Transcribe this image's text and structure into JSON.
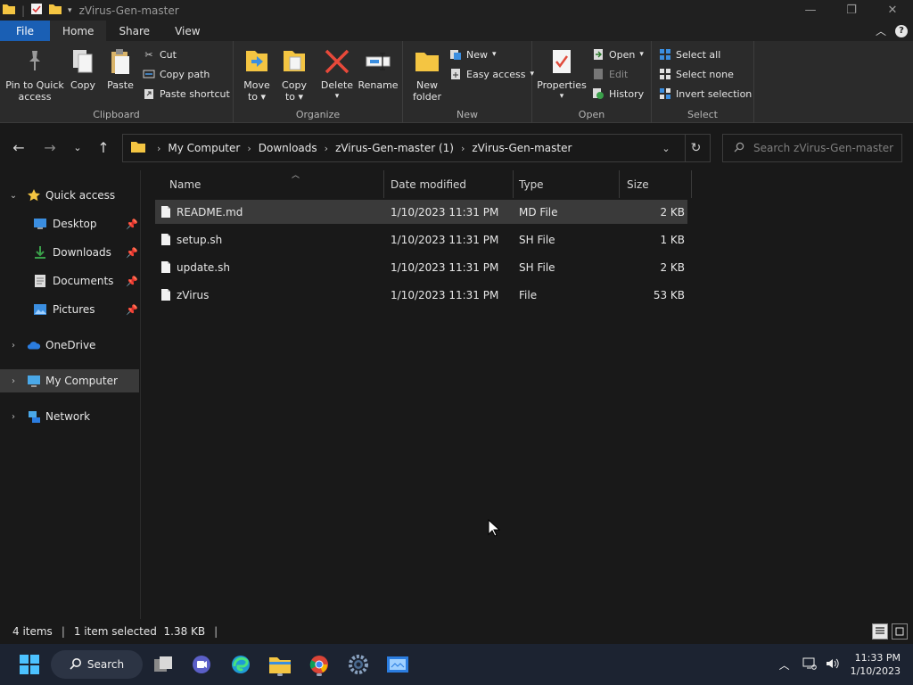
{
  "window": {
    "title": "zVirus-Gen-master"
  },
  "tabs": [
    "File",
    "Home",
    "Share",
    "View"
  ],
  "ribbon": {
    "clipboard": {
      "label": "Clipboard",
      "pin": [
        "Pin to Quick",
        "access"
      ],
      "copy": "Copy",
      "paste": "Paste",
      "cut": "Cut",
      "copy_path": "Copy path",
      "paste_shortcut": "Paste shortcut"
    },
    "organize": {
      "label": "Organize",
      "move_to": [
        "Move",
        "to"
      ],
      "copy_to": [
        "Copy",
        "to"
      ],
      "delete": "Delete",
      "rename": "Rename"
    },
    "new": {
      "label": "New",
      "new_folder": [
        "New",
        "folder"
      ],
      "new_item": "New",
      "easy_access": "Easy access"
    },
    "open": {
      "label": "Open",
      "properties": "Properties",
      "open": "Open",
      "edit": "Edit",
      "history": "History"
    },
    "select": {
      "label": "Select",
      "select_all": "Select all",
      "select_none": "Select none",
      "invert_selection": "Invert selection"
    }
  },
  "address": {
    "segments": [
      "My Computer",
      "Downloads",
      "zVirus-Gen-master (1)",
      "zVirus-Gen-master"
    ]
  },
  "search": {
    "placeholder": "Search zVirus-Gen-master"
  },
  "nav": {
    "quick_access": "Quick access",
    "desktop": "Desktop",
    "downloads": "Downloads",
    "documents": "Documents",
    "pictures": "Pictures",
    "onedrive": "OneDrive",
    "my_computer": "My Computer",
    "network": "Network"
  },
  "columns": {
    "name": "Name",
    "date": "Date modified",
    "type": "Type",
    "size": "Size"
  },
  "files": [
    {
      "name": "README.md",
      "date": "1/10/2023 11:31 PM",
      "type": "MD File",
      "size": "2 KB"
    },
    {
      "name": "setup.sh",
      "date": "1/10/2023 11:31 PM",
      "type": "SH File",
      "size": "1 KB"
    },
    {
      "name": "update.sh",
      "date": "1/10/2023 11:31 PM",
      "type": "SH File",
      "size": "2 KB"
    },
    {
      "name": "zVirus",
      "date": "1/10/2023 11:31 PM",
      "type": "File",
      "size": "53 KB"
    }
  ],
  "status": {
    "count": "4 items",
    "selection": "1 item selected  1.38 KB"
  },
  "taskbar": {
    "search_label": "Search",
    "time": "11:33 PM",
    "date": "1/10/2023"
  },
  "colors": {
    "accent": "#1a5fb4",
    "selection": "#3a3a3a",
    "background": "#191919"
  }
}
